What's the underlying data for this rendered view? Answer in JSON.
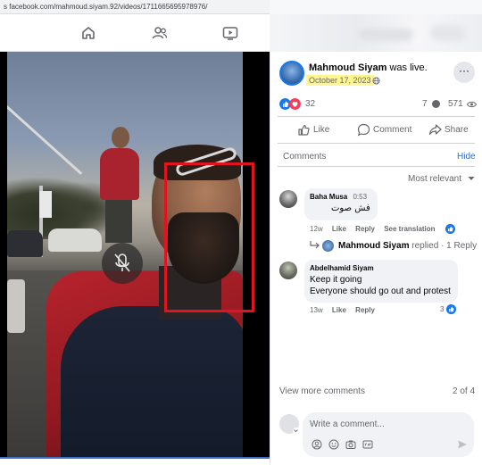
{
  "browser": {
    "url": "s facebook.com/mahmoud.siyam.92/videos/1711665695978976/"
  },
  "nav": {
    "icons": [
      "home-icon",
      "people-icon",
      "video-icon"
    ]
  },
  "post": {
    "author": "Mahmoud Siyam",
    "status": "was live.",
    "date": "October 17, 2023",
    "privacy_icon": "globe-icon",
    "more": "···"
  },
  "stats": {
    "reactions": "32",
    "comments": "7",
    "views": "571"
  },
  "actions": {
    "like": "Like",
    "comment": "Comment",
    "share": "Share"
  },
  "comments_section": {
    "label": "Comments",
    "hide": "Hide",
    "sort": "Most relevant",
    "items": [
      {
        "name": "Baha Musa",
        "time": "0:53",
        "text": "فش صوت",
        "age": "12w",
        "like": "Like",
        "reply": "Reply",
        "see_translation": "See translation",
        "reply_summary": {
          "author": "Mahmoud Siyam",
          "action": "replied",
          "count": "· 1 Reply"
        }
      },
      {
        "name": "Abdelhamid Siyam",
        "lines": [
          "Keep it going",
          "Everyone should go out and protest"
        ],
        "age": "13w",
        "like": "Like",
        "reply": "Reply",
        "likes": "3"
      }
    ],
    "view_more": "View more comments",
    "count": "2 of 4"
  },
  "composer": {
    "placeholder": "Write a comment..."
  },
  "colors": {
    "accent": "#1877f2",
    "highlight": "#fff68f",
    "annotation_box": "#e0141e"
  }
}
